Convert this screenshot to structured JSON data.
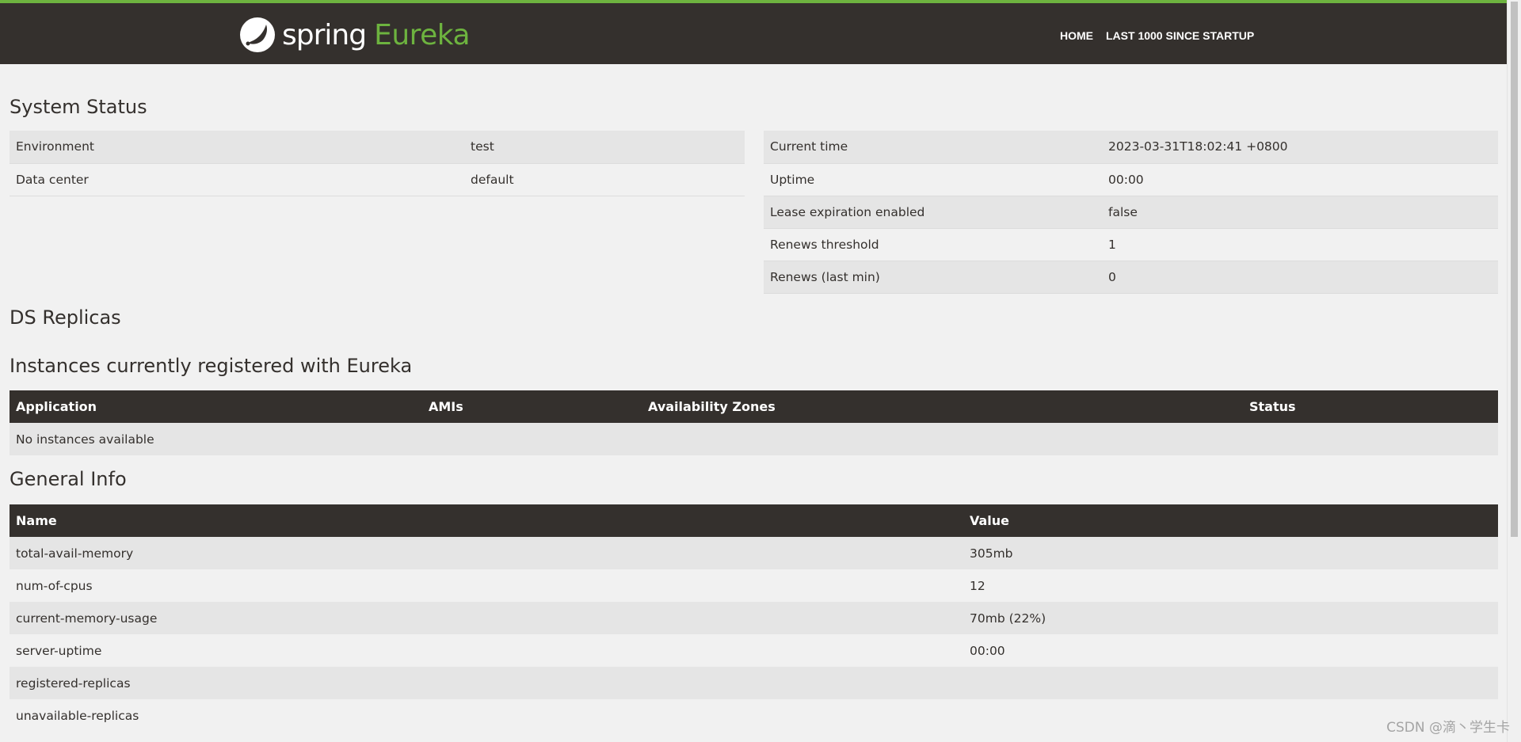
{
  "brand": {
    "spring": "spring",
    "eureka": "Eureka",
    "accent_color": "#6db33f",
    "nav_bg": "#34302d"
  },
  "nav": {
    "home": "HOME",
    "last1000": "LAST 1000 SINCE STARTUP"
  },
  "sections": {
    "system_status": "System Status",
    "ds_replicas": "DS Replicas",
    "instances": "Instances currently registered with Eureka",
    "general_info": "General Info"
  },
  "status_left": [
    {
      "label": "Environment",
      "value": "test"
    },
    {
      "label": "Data center",
      "value": "default"
    }
  ],
  "status_right": [
    {
      "label": "Current time",
      "value": "2023-03-31T18:02:41 +0800"
    },
    {
      "label": "Uptime",
      "value": "00:00"
    },
    {
      "label": "Lease expiration enabled",
      "value": "false"
    },
    {
      "label": "Renews threshold",
      "value": "1"
    },
    {
      "label": "Renews (last min)",
      "value": "0"
    }
  ],
  "instances_table": {
    "headers": [
      "Application",
      "AMIs",
      "Availability Zones",
      "Status"
    ],
    "empty_text": "No instances available"
  },
  "general_table": {
    "headers": [
      "Name",
      "Value"
    ],
    "rows": [
      {
        "name": "total-avail-memory",
        "value": "305mb"
      },
      {
        "name": "num-of-cpus",
        "value": "12"
      },
      {
        "name": "current-memory-usage",
        "value": "70mb (22%)"
      },
      {
        "name": "server-uptime",
        "value": "00:00"
      },
      {
        "name": "registered-replicas",
        "value": ""
      },
      {
        "name": "unavailable-replicas",
        "value": ""
      }
    ]
  },
  "watermark": "CSDN @滴丶学生卡"
}
